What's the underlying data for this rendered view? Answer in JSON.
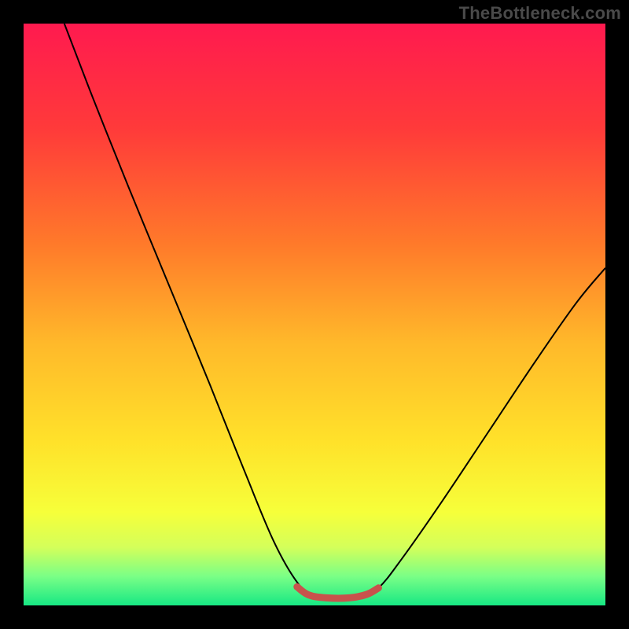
{
  "watermark": "TheBottleneck.com",
  "chart_data": {
    "type": "line",
    "title": "",
    "xlabel": "",
    "ylabel": "",
    "xlim": [
      0,
      100
    ],
    "ylim": [
      0,
      100
    ],
    "grid": false,
    "legend": false,
    "background_gradient_stops": [
      {
        "offset": 0.0,
        "color": "#ff1a4f"
      },
      {
        "offset": 0.18,
        "color": "#ff3a3a"
      },
      {
        "offset": 0.38,
        "color": "#ff7a2a"
      },
      {
        "offset": 0.55,
        "color": "#ffb92a"
      },
      {
        "offset": 0.72,
        "color": "#ffe22a"
      },
      {
        "offset": 0.84,
        "color": "#f6ff3a"
      },
      {
        "offset": 0.9,
        "color": "#d4ff5a"
      },
      {
        "offset": 0.95,
        "color": "#7aff86"
      },
      {
        "offset": 1.0,
        "color": "#17e884"
      }
    ],
    "series": [
      {
        "name": "bottleneck-curve",
        "color": "#000000",
        "width": 2,
        "points": [
          {
            "x": 7,
            "y": 100
          },
          {
            "x": 12,
            "y": 87
          },
          {
            "x": 18,
            "y": 72
          },
          {
            "x": 25,
            "y": 55
          },
          {
            "x": 32,
            "y": 38
          },
          {
            "x": 38,
            "y": 23
          },
          {
            "x": 43,
            "y": 11
          },
          {
            "x": 47,
            "y": 4
          },
          {
            "x": 50,
            "y": 1.5
          },
          {
            "x": 54,
            "y": 1.2
          },
          {
            "x": 58,
            "y": 1.5
          },
          {
            "x": 61,
            "y": 3
          },
          {
            "x": 65,
            "y": 8
          },
          {
            "x": 72,
            "y": 18
          },
          {
            "x": 80,
            "y": 30
          },
          {
            "x": 88,
            "y": 42
          },
          {
            "x": 95,
            "y": 52
          },
          {
            "x": 100,
            "y": 58
          }
        ]
      },
      {
        "name": "optimal-band-marker",
        "color": "#c8524c",
        "width": 9,
        "linecap": "round",
        "points": [
          {
            "x": 47,
            "y": 3.2
          },
          {
            "x": 49,
            "y": 1.8
          },
          {
            "x": 52,
            "y": 1.3
          },
          {
            "x": 56,
            "y": 1.3
          },
          {
            "x": 59,
            "y": 1.9
          },
          {
            "x": 61,
            "y": 3.0
          }
        ]
      }
    ]
  }
}
